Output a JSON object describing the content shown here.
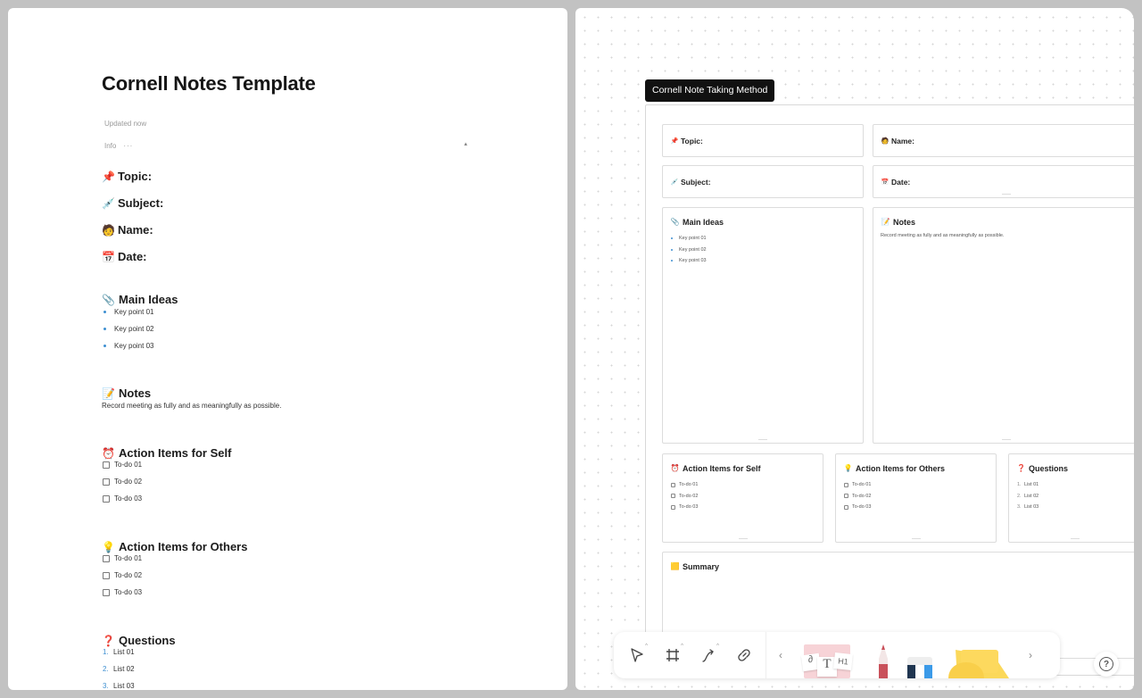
{
  "document": {
    "title": "Cornell Notes Template",
    "updated": "Updated now",
    "info_label": "Info",
    "info_more": "···",
    "collapse_glyph": "▲",
    "fields": [
      {
        "icon": "pushpin-icon",
        "glyph": "📌",
        "label": "Topic:"
      },
      {
        "icon": "syringe-icon",
        "glyph": "💉",
        "label": "Subject:"
      },
      {
        "icon": "person-icon",
        "glyph": "🧑",
        "label": "Name:"
      },
      {
        "icon": "calendar-icon",
        "glyph": "📅",
        "label": "Date:"
      }
    ],
    "main_ideas": {
      "glyph": "📎",
      "title": "Main Ideas",
      "items": [
        "Key point 01",
        "Key point 02",
        "Key point 03"
      ]
    },
    "notes": {
      "glyph": "📝",
      "title": "Notes",
      "text": "Record meeting as fully and as meaningfully as possible."
    },
    "action_self": {
      "glyph": "⏰",
      "title": "Action Items for Self",
      "items": [
        "To-do 01",
        "To-do 02",
        "To-do 03"
      ]
    },
    "action_others": {
      "glyph": "💡",
      "title": "Action Items for Others",
      "items": [
        "To-do 01",
        "To-do 02",
        "To-do 03"
      ]
    },
    "questions": {
      "glyph": "❓",
      "title": "Questions",
      "items": [
        {
          "n": "1.",
          "text": "List 01"
        },
        {
          "n": "2.",
          "text": "List 02"
        },
        {
          "n": "3.",
          "text": "List 03"
        }
      ]
    }
  },
  "canvas": {
    "frame_label": "Cornell Note Taking Method",
    "topic": {
      "glyph": "📌",
      "label": "Topic:"
    },
    "name": {
      "glyph": "🧑",
      "label": "Name:"
    },
    "subject": {
      "glyph": "💉",
      "label": "Subject:"
    },
    "date": {
      "glyph": "📅",
      "label": "Date:"
    },
    "main_ideas": {
      "glyph": "📎",
      "title": "Main Ideas",
      "items": [
        "Key point 01",
        "Key point 02",
        "Key point 03"
      ]
    },
    "notes": {
      "glyph": "📝",
      "title": "Notes",
      "text": "Record meeting as fully and as meaningfully as possible."
    },
    "action_self": {
      "glyph": "⏰",
      "title": "Action Items for Self",
      "items": [
        "To-do 01",
        "To-do 02",
        "To-do 03"
      ]
    },
    "action_others": {
      "glyph": "💡",
      "title": "Action Items for Others",
      "items": [
        "To-do 01",
        "To-do 02",
        "To-do 03"
      ]
    },
    "questions": {
      "glyph": "❓",
      "title": "Questions",
      "items": [
        {
          "n": "1.",
          "text": "List 01"
        },
        {
          "n": "2.",
          "text": "List 02"
        },
        {
          "n": "3.",
          "text": "List 03"
        }
      ]
    },
    "summary": {
      "glyph": "🟨",
      "title": "Summary"
    }
  },
  "toolbar": {
    "tools": [
      "select-tool",
      "frame-tool",
      "connector-tool",
      "link-tool"
    ],
    "prev": "‹",
    "next": "›",
    "sticker_labels": {
      "text": "T",
      "heading": "H1"
    },
    "help": "?"
  },
  "colors": {
    "accent_blue": "#3d8fd1",
    "frame_label_bg": "#111111",
    "sticky_yellow": "#fbd85a",
    "pencil_red": "#c9515b"
  }
}
